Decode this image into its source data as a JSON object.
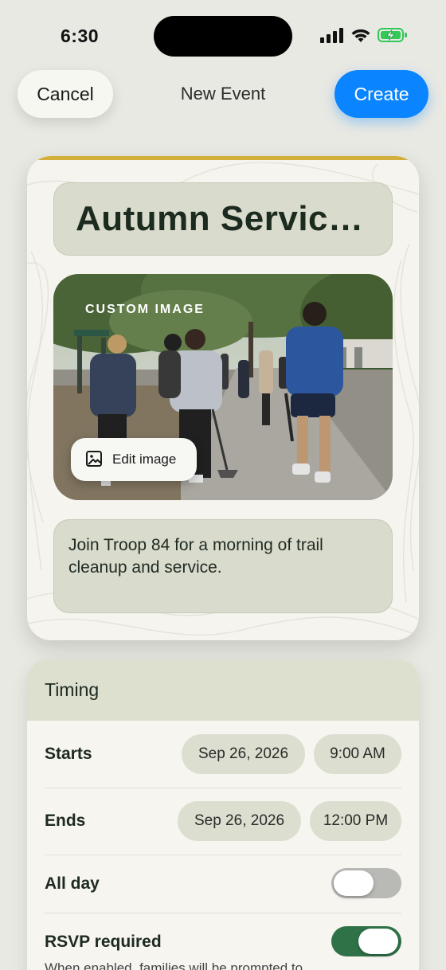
{
  "status_bar": {
    "time": "6:30",
    "icons": [
      "signal-icon",
      "wifi-icon",
      "battery-charging-icon"
    ],
    "battery_color": "#34c759"
  },
  "nav": {
    "cancel_label": "Cancel",
    "title": "New Event",
    "create_label": "Create",
    "accent": "#0a84ff"
  },
  "event": {
    "title": "Autumn Service Day",
    "image_tag": "CUSTOM IMAGE",
    "edit_image_label": "Edit image",
    "description": "Join Troop 84 for a morning of trail cleanup and service.",
    "accent_color": "#d3ae3a"
  },
  "timing": {
    "header": "Timing",
    "starts": {
      "label": "Starts",
      "date": "Sep 26, 2026",
      "time": "9:00 AM"
    },
    "ends": {
      "label": "Ends",
      "date": "Sep 26, 2026",
      "time": "12:00 PM"
    },
    "all_day": {
      "label": "All day",
      "on": false
    },
    "rsvp": {
      "label": "RSVP required",
      "on": true
    },
    "rsvp_hint": "When enabled, families will be prompted to"
  }
}
